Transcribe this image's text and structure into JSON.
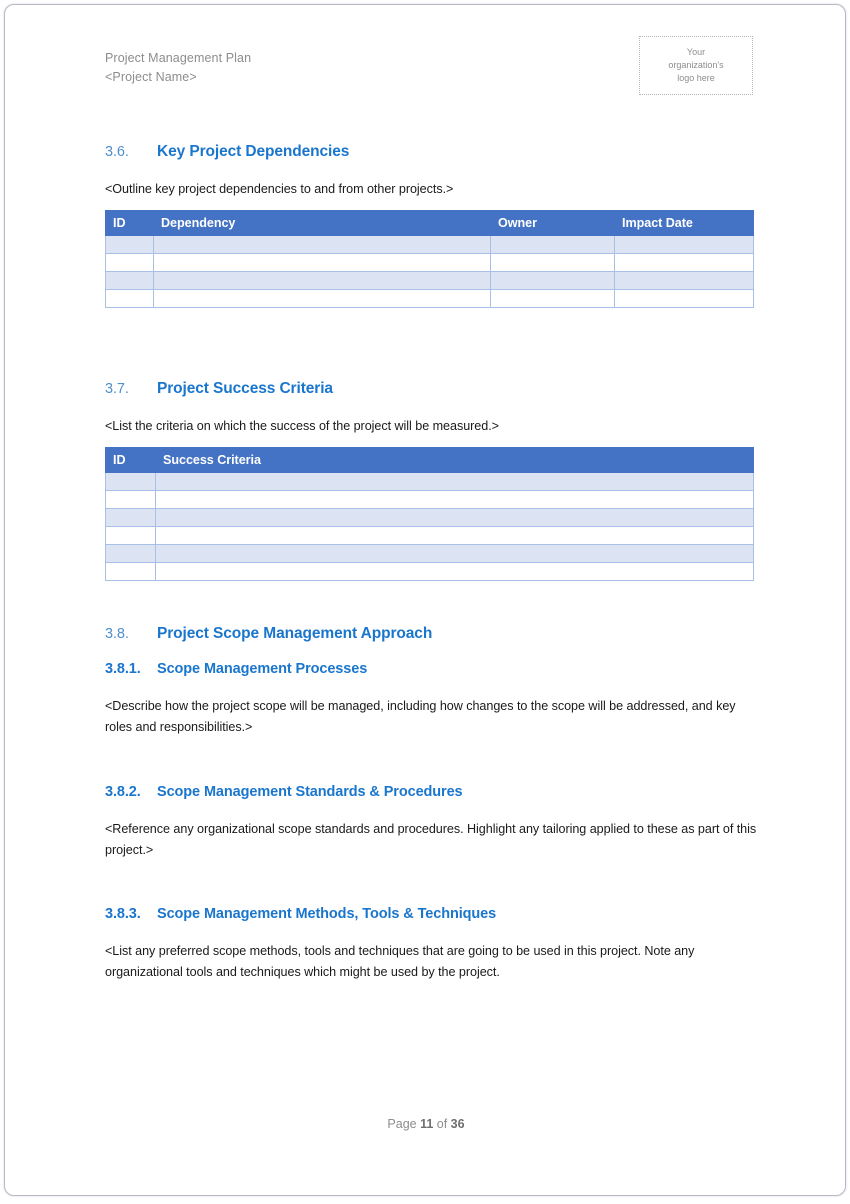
{
  "header": {
    "title_line1": "Project Management Plan",
    "title_line2": "<Project Name>",
    "logo_placeholder": {
      "line1": "Your",
      "line2": "organization's",
      "line3": "logo here"
    }
  },
  "colors": {
    "heading_blue": "#1a76cd",
    "table_header_blue": "#4472c4",
    "table_row_shade": "#dce3f2",
    "table_border": "#a8bfe6",
    "body_text": "#1a1a1a",
    "muted_text": "#8d8d8d"
  },
  "sections": [
    {
      "number": "3.6.",
      "title": "Key Project Dependencies",
      "intro": "<Outline key project dependencies to and from other projects.>"
    },
    {
      "number": "3.7.",
      "title": "Project Success Criteria",
      "intro": "<List the criteria on which the success of the project will be measured.>"
    },
    {
      "number": "3.8.",
      "title": "Project Scope Management Approach"
    },
    {
      "number": "3.8.1.",
      "title": "Scope Management Processes",
      "body": "<Describe how the project scope will be managed, including how changes to the scope will be addressed, and key roles and responsibilities.>"
    },
    {
      "number": "3.8.2.",
      "title": "Scope Management Standards & Procedures",
      "body": "<Reference any organizational scope standards and procedures. Highlight any tailoring applied to these as part of this project.>"
    },
    {
      "number": "3.8.3.",
      "title": "Scope Management Methods, Tools & Techniques",
      "body": "<List any preferred scope methods, tools and techniques that are going to be used in this project. Note any organizational tools and techniques which might be used by the project."
    }
  ],
  "dependencies_table": {
    "columns": [
      "ID",
      "Dependency",
      "Owner",
      "Impact Date"
    ],
    "rows": [
      [
        "",
        "",
        "",
        ""
      ],
      [
        "",
        "",
        "",
        ""
      ],
      [
        "",
        "",
        "",
        ""
      ],
      [
        "",
        "",
        "",
        ""
      ]
    ]
  },
  "success_criteria_table": {
    "columns": [
      "ID",
      "Success Criteria"
    ],
    "rows": [
      [
        "",
        ""
      ],
      [
        "",
        ""
      ],
      [
        "",
        ""
      ],
      [
        "",
        ""
      ],
      [
        "",
        ""
      ],
      [
        "",
        ""
      ]
    ]
  },
  "footer": {
    "prefix": "Page ",
    "current_page": "11",
    "middle": " of ",
    "total_pages": "36"
  }
}
